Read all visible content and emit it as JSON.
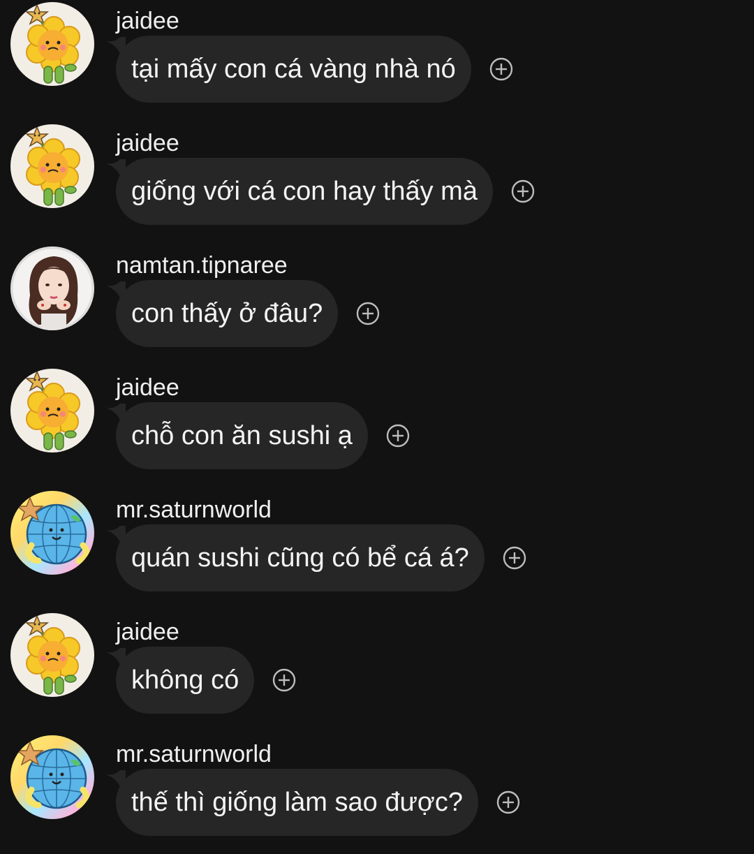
{
  "messages": [
    {
      "avatar": "sunflower-cookie-avatar",
      "username": "jaidee",
      "text": "tại mấy con cá vàng nhà nó"
    },
    {
      "avatar": "sunflower-cookie-avatar",
      "username": "jaidee",
      "text": "giống với cá con hay thấy mà"
    },
    {
      "avatar": "girl-photo-avatar",
      "username": "namtan.tipnaree",
      "text": "con thấy ở đâu?"
    },
    {
      "avatar": "sunflower-cookie-avatar",
      "username": "jaidee",
      "text": "chỗ con ăn sushi ạ"
    },
    {
      "avatar": "globe-cartoon-avatar",
      "username": "mr.saturnworld",
      "text": "quán sushi cũng có bể cá á?"
    },
    {
      "avatar": "sunflower-cookie-avatar",
      "username": "jaidee",
      "text": "không có"
    },
    {
      "avatar": "globe-cartoon-avatar",
      "username": "mr.saturnworld",
      "text": "thế thì giống làm sao được?"
    }
  ],
  "react_icon": "add-reaction-icon",
  "colors": {
    "background": "#121212",
    "bubble": "#262626",
    "text": "#f4f4f4",
    "icon": "#bdbdbd"
  }
}
